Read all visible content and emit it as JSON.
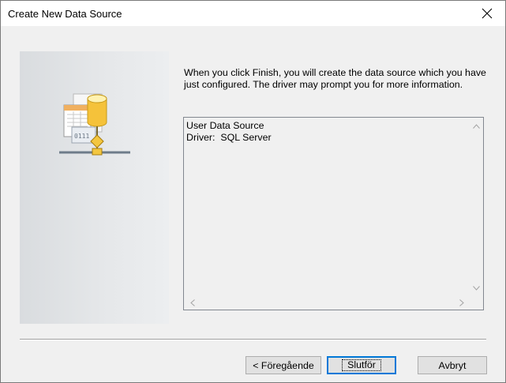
{
  "window": {
    "title": "Create New Data Source",
    "close_icon": "close-icon"
  },
  "intro_text": "When you click Finish, you will create the data source which you have just configured.  The driver may prompt you for more information.",
  "summary": {
    "lines": [
      "User Data Source",
      "Driver:  SQL Server"
    ]
  },
  "buttons": {
    "back": "< Föregående",
    "finish": "Slutför",
    "cancel": "Avbryt"
  },
  "colors": {
    "accent": "#0078d7",
    "dialog_bg": "#f0f0f0"
  }
}
